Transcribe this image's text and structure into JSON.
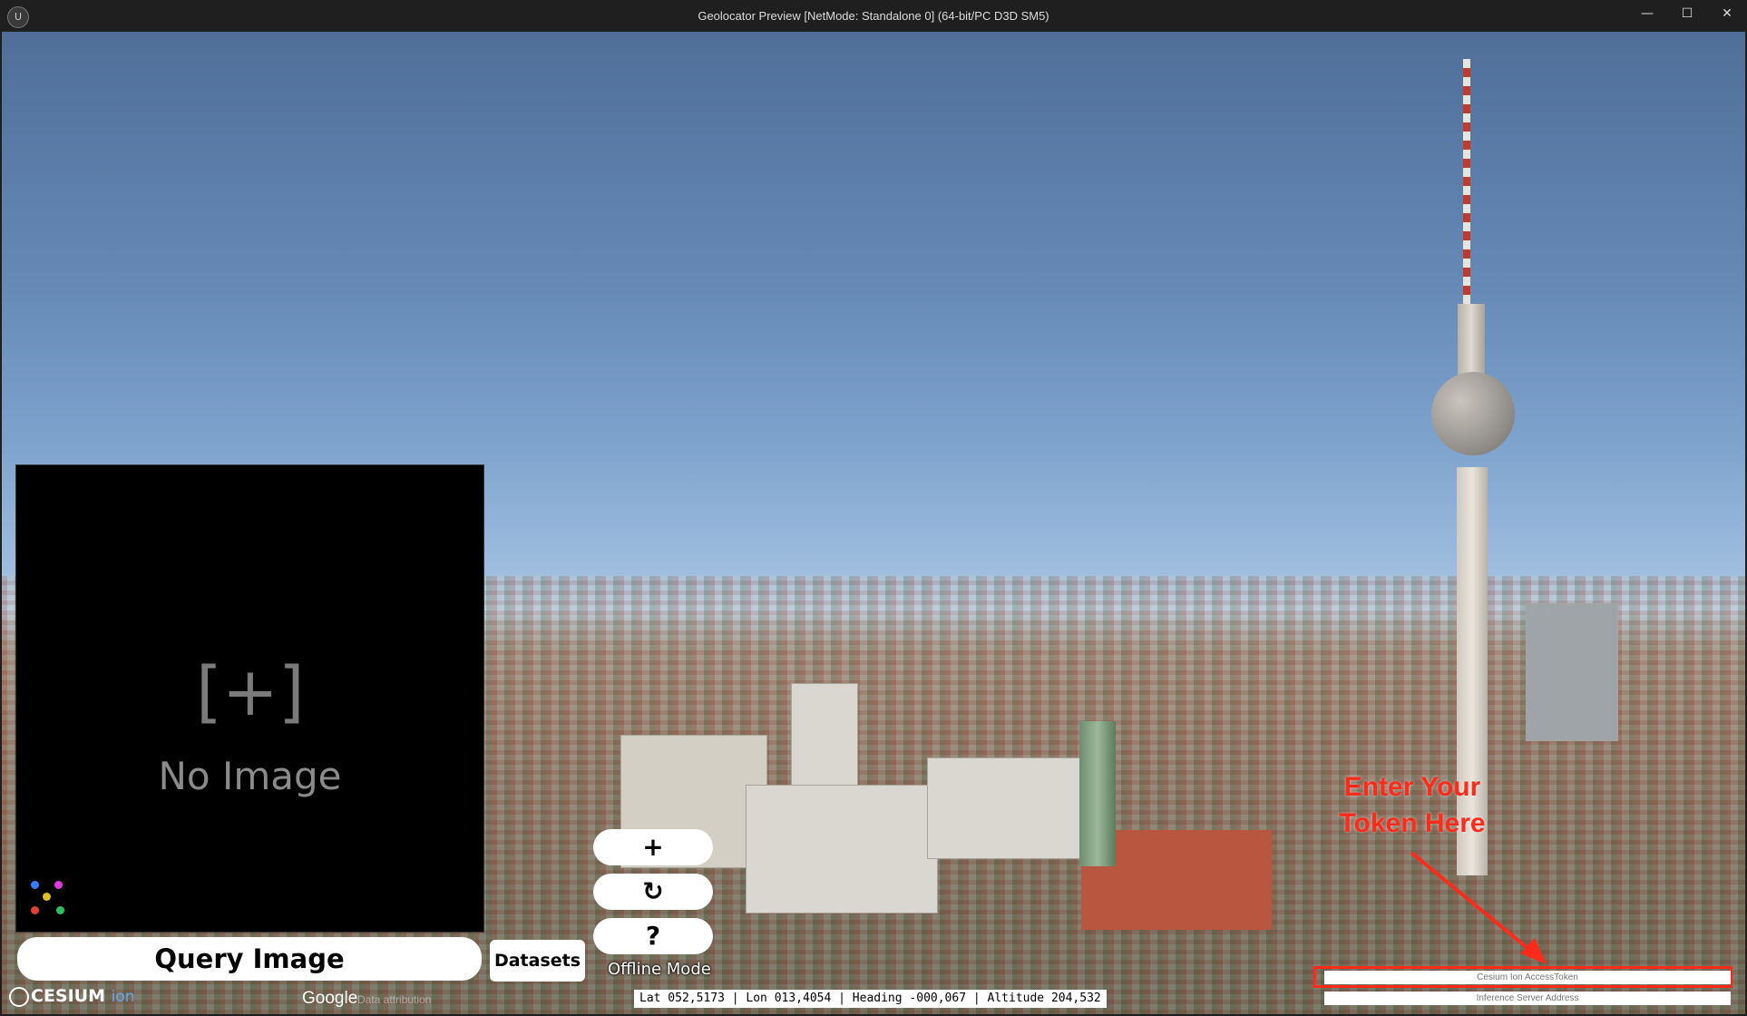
{
  "window": {
    "title": "Geolocator Preview [NetMode: Standalone 0]  (64-bit/PC D3D SM5)",
    "minimize_glyph": "—",
    "maximize_glyph": "☐",
    "close_glyph": "✕",
    "app_icon": "unreal-logo-icon"
  },
  "image_panel": {
    "placeholder": "[+]",
    "empty_text": "No Image",
    "dot_colors": [
      "#3a7bff",
      "#e03ae0",
      "#e0c020",
      "#e04030",
      "#30c060"
    ]
  },
  "controls": {
    "query_button": "Query Image",
    "datasets_button": "Datasets",
    "add_button": "+",
    "refresh_button": "↻",
    "help_button": "?",
    "offline_mode": "Offline Mode"
  },
  "status": {
    "coordinates": "Lat 052,5173 | Lon 013,4054 | Heading -000,067 | Altitude 204,532"
  },
  "credits": {
    "cesium": "CESIUM",
    "ion": "ion",
    "google": "Google",
    "google_attr": "Data attribution"
  },
  "token": {
    "annotation": "Enter Your Token Here",
    "annotation_color": "#ff2a1a",
    "access_token_placeholder": "Cesium Ion AccessToken",
    "server_placeholder": "Inference Server Address"
  }
}
